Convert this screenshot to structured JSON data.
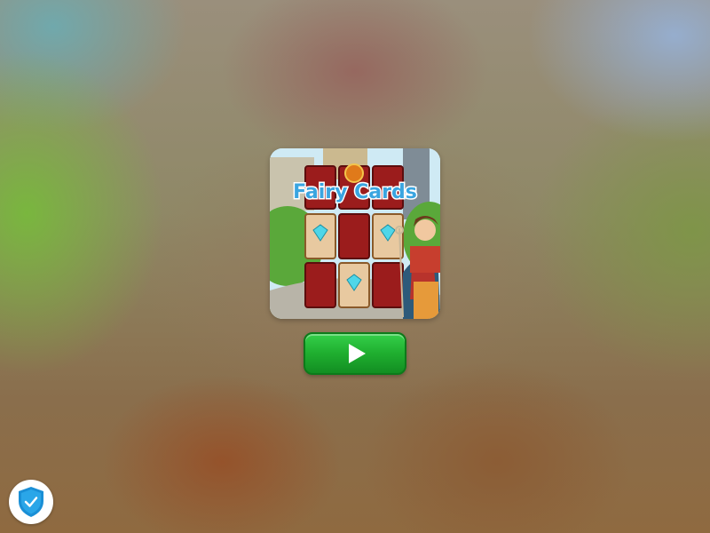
{
  "game": {
    "title": "Fairy Cards",
    "play_button_label": "Play"
  },
  "badge": {
    "icon": "shield-check-icon",
    "color": "#1a8fd6"
  },
  "colors": {
    "play_button": "#1fae2f",
    "card_back": "#9b1c1c",
    "gem": "#4fd6e8"
  }
}
